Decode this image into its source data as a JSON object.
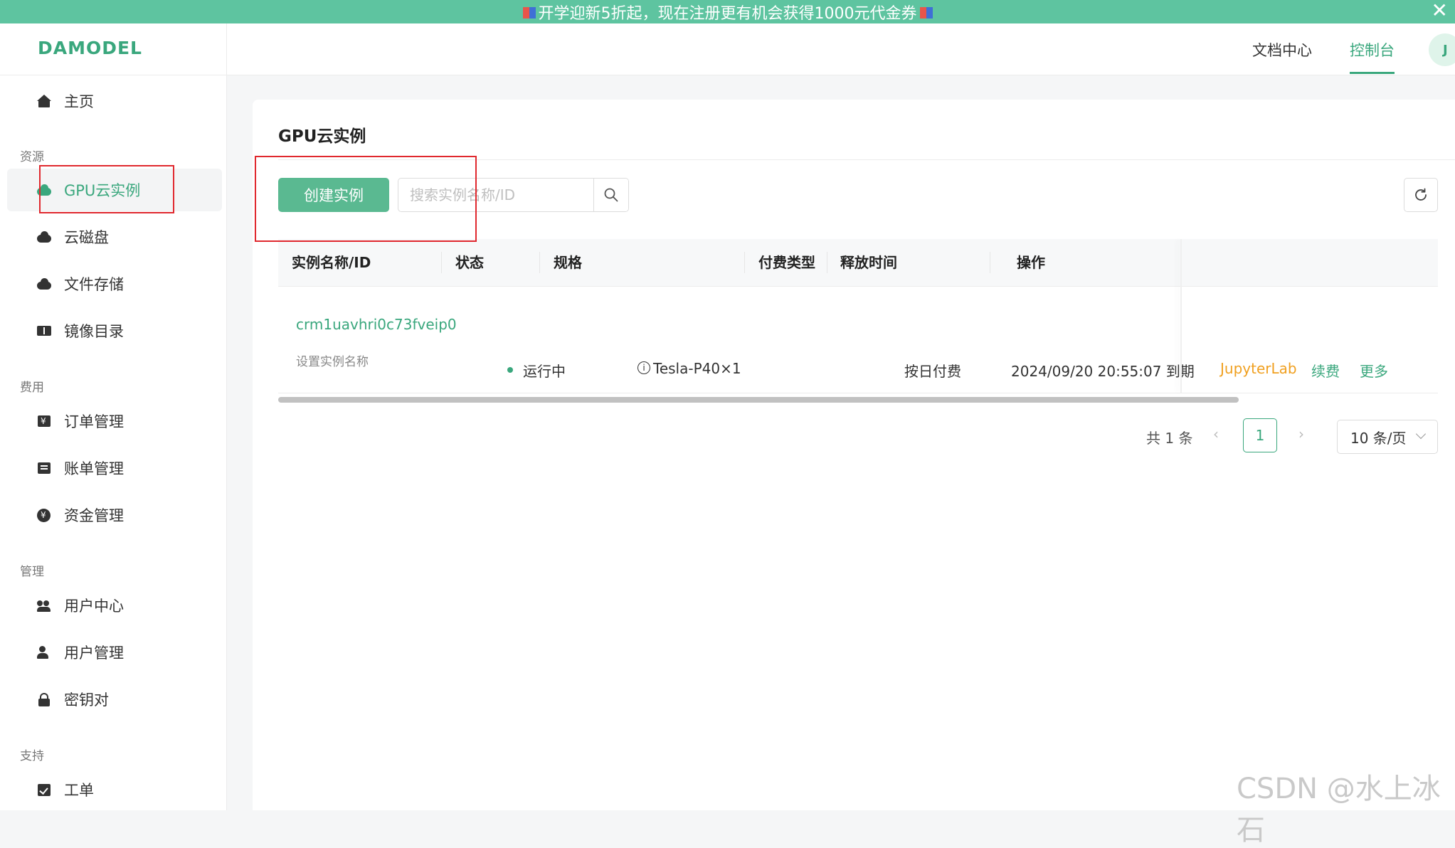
{
  "banner": {
    "text": "开学迎新5折起，现在注册更有机会获得1000元代金券",
    "close": "✕"
  },
  "header": {
    "logo": "DAMODEL",
    "nav": {
      "docs": "文档中心",
      "console": "控制台"
    },
    "avatar": "J"
  },
  "sidebar": {
    "home": "主页",
    "sections": {
      "resources": "资源",
      "fees": "费用",
      "manage": "管理",
      "support": "支持"
    },
    "items": {
      "gpu": "GPU云实例",
      "disk": "云磁盘",
      "file": "文件存储",
      "image": "镜像目录",
      "orders": "订单管理",
      "bills": "账单管理",
      "funds": "资金管理",
      "usercenter": "用户中心",
      "usermanage": "用户管理",
      "keys": "密钥对",
      "ticket": "工单"
    }
  },
  "main": {
    "title": "GPU云实例",
    "create_button": "创建实例",
    "search_placeholder": "搜索实例名称/ID",
    "table": {
      "headers": {
        "name": "实例名称/ID",
        "status": "状态",
        "spec": "规格",
        "pay": "付费类型",
        "release": "释放时间",
        "ops": "操作"
      },
      "rows": [
        {
          "id": "crm1uavhri0c73fveip0",
          "name_hint": "设置实例名称",
          "status": "运行中",
          "spec": "Tesla-P40×1",
          "pay": "按日付费",
          "release": "2024/09/20 20:55:07 到期",
          "ops": {
            "jupyter": "JupyterLab",
            "renew": "续费",
            "more": "更多"
          }
        }
      ]
    },
    "pagination": {
      "total": "共 1 条",
      "current": "1",
      "page_size": "10 条/页"
    }
  },
  "watermark": "CSDN @水上冰石",
  "colors": {
    "brand": "#3aa77d",
    "banner": "#5ec4a0",
    "highlight": "#e0282e",
    "jupyter": "#f0a020"
  }
}
